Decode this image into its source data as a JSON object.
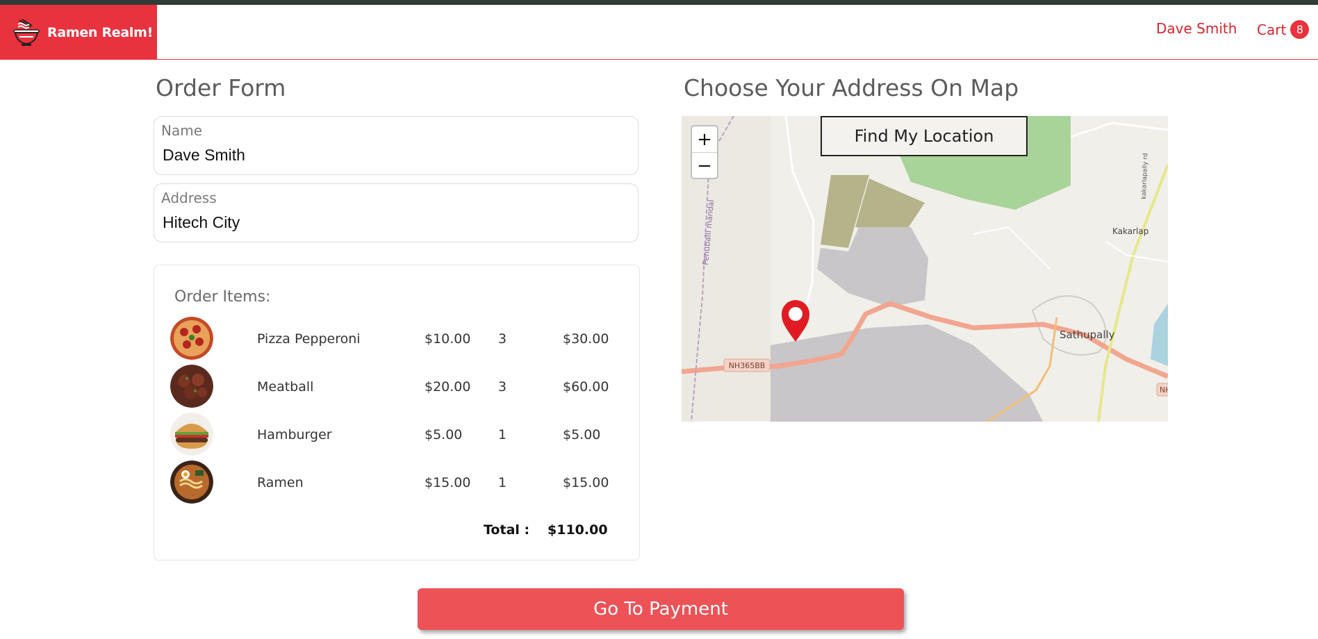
{
  "navbar": {
    "brand": "Ramen Realm!",
    "user": "Dave Smith",
    "cart_label": "Cart",
    "cart_count": "8"
  },
  "order_form": {
    "title": "Order Form",
    "name_label": "Name",
    "name_value": "Dave Smith",
    "address_label": "Address",
    "address_value": "Hitech City"
  },
  "order_items": {
    "title": "Order Items:",
    "items": [
      {
        "name": "Pizza Pepperoni",
        "price": "$10.00",
        "qty": "3",
        "subtotal": "$30.00",
        "image": "pizza-image"
      },
      {
        "name": "Meatball",
        "price": "$20.00",
        "qty": "3",
        "subtotal": "$60.00",
        "image": "meatball-image"
      },
      {
        "name": "Hamburger",
        "price": "$5.00",
        "qty": "1",
        "subtotal": "$5.00",
        "image": "hamburger-image"
      },
      {
        "name": "Ramen",
        "price": "$15.00",
        "qty": "1",
        "subtotal": "$15.00",
        "image": "ramen-image"
      }
    ],
    "total_label": "Total :",
    "total_value": "$110.00"
  },
  "map_section": {
    "title": "Choose Your Address On Map",
    "find_location": "Find My Location",
    "zoom_in": "+",
    "zoom_out": "−",
    "labels": {
      "town": "Sathupally",
      "road": "NH365BB",
      "mandal": "Penuballi mandal",
      "village": "Kakarlap",
      "road2": "kakarlapally rd",
      "road_edge": "NH"
    }
  },
  "payment_button": "Go To Payment",
  "colors": {
    "brand_red": "#e8323d",
    "pay_button": "#ec5256",
    "top_strip": "#2f3b35"
  }
}
